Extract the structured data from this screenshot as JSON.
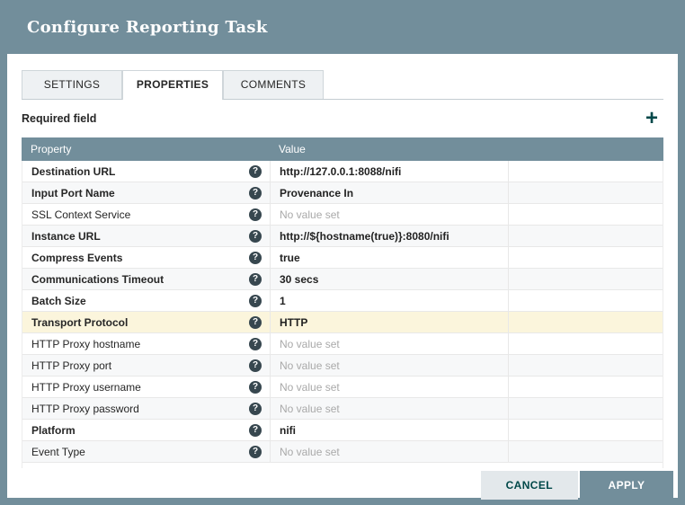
{
  "dialog": {
    "title": "Configure Reporting Task"
  },
  "tabs": [
    {
      "label": "SETTINGS",
      "active": false
    },
    {
      "label": "PROPERTIES",
      "active": true
    },
    {
      "label": "COMMENTS",
      "active": false
    }
  ],
  "labels": {
    "required_field": "Required field",
    "add_icon": "+",
    "help_icon": "?"
  },
  "table": {
    "headers": {
      "property": "Property",
      "value": "Value"
    },
    "rows": [
      {
        "property": "Destination URL",
        "value": "http://127.0.0.1:8088/nifi",
        "required": true,
        "is_set": true,
        "highlighted": false
      },
      {
        "property": "Input Port Name",
        "value": "Provenance In",
        "required": true,
        "is_set": true,
        "highlighted": false
      },
      {
        "property": "SSL Context Service",
        "value": "No value set",
        "required": false,
        "is_set": false,
        "highlighted": false
      },
      {
        "property": "Instance URL",
        "value": "http://${hostname(true)}:8080/nifi",
        "required": true,
        "is_set": true,
        "highlighted": false
      },
      {
        "property": "Compress Events",
        "value": "true",
        "required": true,
        "is_set": true,
        "highlighted": false
      },
      {
        "property": "Communications Timeout",
        "value": "30 secs",
        "required": true,
        "is_set": true,
        "highlighted": false
      },
      {
        "property": "Batch Size",
        "value": "1",
        "required": true,
        "is_set": true,
        "highlighted": false
      },
      {
        "property": "Transport Protocol",
        "value": "HTTP",
        "required": true,
        "is_set": true,
        "highlighted": true
      },
      {
        "property": "HTTP Proxy hostname",
        "value": "No value set",
        "required": false,
        "is_set": false,
        "highlighted": false
      },
      {
        "property": "HTTP Proxy port",
        "value": "No value set",
        "required": false,
        "is_set": false,
        "highlighted": false
      },
      {
        "property": "HTTP Proxy username",
        "value": "No value set",
        "required": false,
        "is_set": false,
        "highlighted": false
      },
      {
        "property": "HTTP Proxy password",
        "value": "No value set",
        "required": false,
        "is_set": false,
        "highlighted": false
      },
      {
        "property": "Platform",
        "value": "nifi",
        "required": true,
        "is_set": true,
        "highlighted": false
      },
      {
        "property": "Event Type",
        "value": "No value set",
        "required": false,
        "is_set": false,
        "highlighted": false
      }
    ]
  },
  "buttons": {
    "cancel": "CANCEL",
    "apply": "APPLY"
  },
  "colors": {
    "header_bg": "#728E9B",
    "accent_dark": "#004849",
    "highlight_row": "#FBF5DC",
    "unset_text": "#A9A9A9",
    "cancel_bg": "#E3E8EB",
    "apply_bg": "#728E9B",
    "help_icon_bg": "#37474F"
  }
}
